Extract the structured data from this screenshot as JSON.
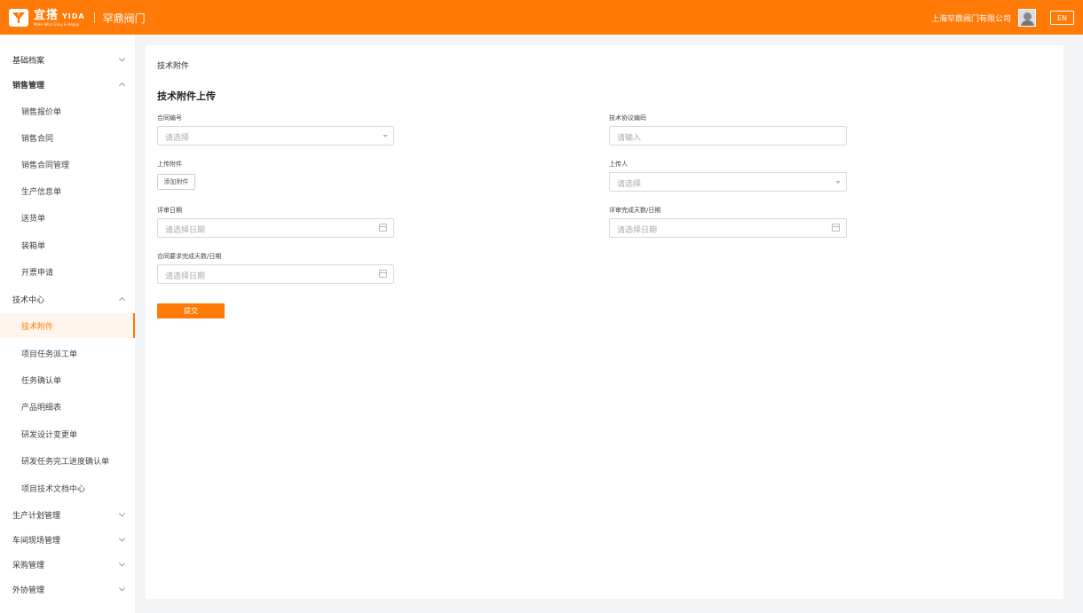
{
  "colors": {
    "accent": "#ff7a07",
    "background": "#f3f4f6",
    "active_bg": "#fff5ed"
  },
  "header": {
    "logo_cn": "宜搭",
    "logo_en": "YIDA",
    "logo_slogan": "Make Work Easy & Happy",
    "company": "罕鼎阀门",
    "user_company": "上海罕鼎阀门有限公司",
    "lang": "EN"
  },
  "sidebar": {
    "items": [
      {
        "label": "基础档案",
        "type": "group",
        "chevron": "down"
      },
      {
        "label": "销售管理",
        "type": "group",
        "chevron": "up",
        "bold": true
      },
      {
        "label": "销售报价单",
        "type": "sub"
      },
      {
        "label": "销售合同",
        "type": "sub"
      },
      {
        "label": "销售合同管理",
        "type": "sub"
      },
      {
        "label": "生产信息单",
        "type": "sub"
      },
      {
        "label": "送货单",
        "type": "sub"
      },
      {
        "label": "装箱单",
        "type": "sub"
      },
      {
        "label": "开票申请",
        "type": "sub"
      },
      {
        "label": "技术中心",
        "type": "group",
        "chevron": "up"
      },
      {
        "label": "技术附件",
        "type": "sub",
        "active": true
      },
      {
        "label": "项目任务派工单",
        "type": "sub"
      },
      {
        "label": "任务确认单",
        "type": "sub"
      },
      {
        "label": "产品明细表",
        "type": "sub"
      },
      {
        "label": "研发设计变更单",
        "type": "sub"
      },
      {
        "label": "研发任务完工进度确认单",
        "type": "sub"
      },
      {
        "label": "项目技术文档中心",
        "type": "sub"
      },
      {
        "label": "生产计划管理",
        "type": "group",
        "chevron": "down"
      },
      {
        "label": "车间现场管理",
        "type": "group",
        "chevron": "down"
      },
      {
        "label": "采购管理",
        "type": "group",
        "chevron": "down"
      },
      {
        "label": "外协管理",
        "type": "group",
        "chevron": "down"
      }
    ]
  },
  "main": {
    "breadcrumb": "技术附件",
    "section_title": "技术附件上传",
    "fields": {
      "contract_no": {
        "label": "合同编号",
        "placeholder": "请选择"
      },
      "tech_protocol": {
        "label": "技术协议编码",
        "placeholder": "请输入"
      },
      "upload_attachment": {
        "label": "上传附件",
        "button": "添加附件"
      },
      "uploader": {
        "label": "上传人",
        "placeholder": "请选择"
      },
      "review_date": {
        "label": "评审日期",
        "placeholder": "请选择日期"
      },
      "review_done": {
        "label": "评审完成天数/日期",
        "placeholder": "请选择日期"
      },
      "contract_required": {
        "label": "合同要求完成天数/日期",
        "placeholder": "请选择日期"
      }
    },
    "submit": "提交"
  }
}
